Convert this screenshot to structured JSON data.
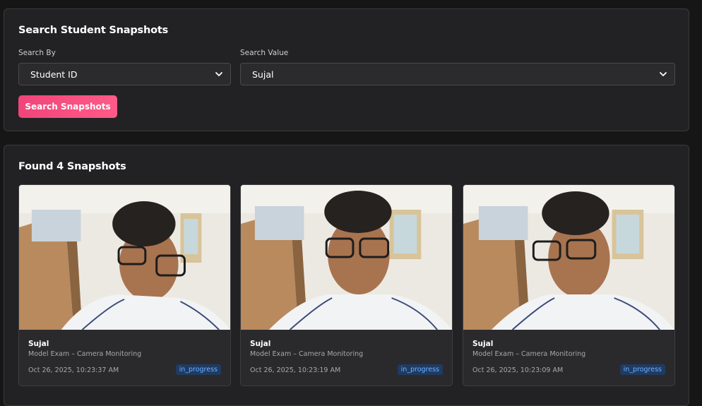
{
  "search": {
    "title": "Search Student Snapshots",
    "search_by_label": "Search By",
    "search_by_value": "Student ID",
    "search_value_label": "Search Value",
    "search_value_value": "Sujal",
    "button_label": "Search Snapshots"
  },
  "results": {
    "title": "Found 4 Snapshots",
    "cards": [
      {
        "name": "Sujal",
        "exam": "Model Exam – Camera Monitoring",
        "timestamp": "Oct 26, 2025, 10:23:37 AM",
        "status": "in_progress"
      },
      {
        "name": "Sujal",
        "exam": "Model Exam – Camera Monitoring",
        "timestamp": "Oct 26, 2025, 10:23:19 AM",
        "status": "in_progress"
      },
      {
        "name": "Sujal",
        "exam": "Model Exam – Camera Monitoring",
        "timestamp": "Oct 26, 2025, 10:23:09 AM",
        "status": "in_progress"
      }
    ]
  },
  "colors": {
    "accent": "#f0457a",
    "status_badge_bg": "#1f3b63",
    "status_badge_text": "#6fb0ff",
    "panel_bg": "#222224",
    "page_bg": "#161616"
  },
  "icons": {
    "select_chevron": "chevron-down-icon"
  }
}
